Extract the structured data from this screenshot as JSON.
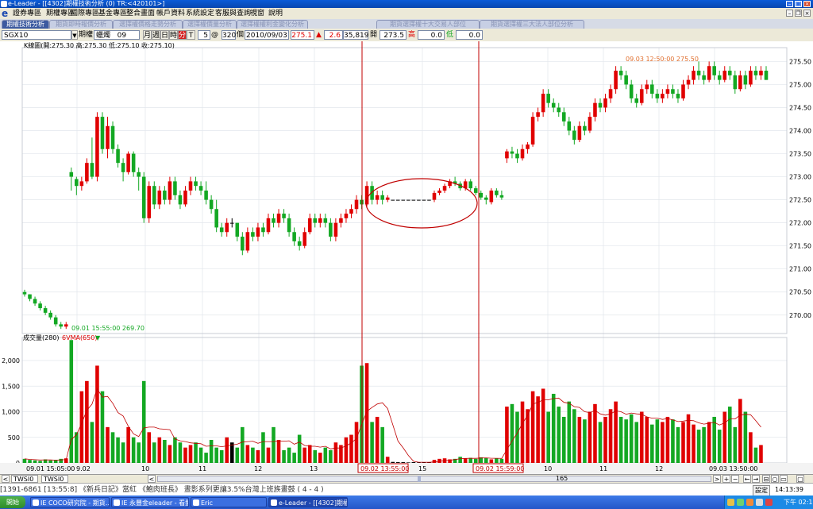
{
  "window": {
    "title": "e-Leader - [[4302]期權技術分析  (0)  TR:<420101>]"
  },
  "menu": {
    "items": [
      "證券專區",
      "期權專區",
      "國際專區",
      "基金專區",
      "整合畫面",
      "帳戶資料",
      "系統設定",
      "客服與查詢",
      "視窗",
      "說明"
    ]
  },
  "tabs": [
    {
      "label": "期權技術分析",
      "active": true
    },
    {
      "label": "期貨即時報價分析",
      "active": false
    },
    {
      "label": "選擇權價格走勢分析",
      "active": false
    },
    {
      "label": "選擇權價量分析",
      "active": false
    },
    {
      "label": "選擇權權利金變化分析",
      "active": false
    },
    {
      "label": "期貨選擇權十大交易人部位",
      "active": false
    },
    {
      "label": "期貨選擇權三大法人部位分析",
      "active": false
    }
  ],
  "toolbar": {
    "symbol": "SGX10",
    "period_label": "期權",
    "chart_type": "蠟燭",
    "chart_type_value": "09",
    "buttons": [
      "月",
      "週",
      "日",
      "時",
      "分",
      "T"
    ],
    "count": "5",
    "count_unit": "@",
    "bars": "320",
    "bars_unit": "個",
    "date": "2010/09/03",
    "last_price": "275.1",
    "change_arrow": "▲",
    "change": "2.6",
    "volume": "35,819",
    "open_label": "開",
    "open": "273.5",
    "high_label": "高",
    "high": "0.0",
    "low_label": "低",
    "low": "0.0"
  },
  "price_panel": {
    "header": "K線圖(開:275.30 高:275.30 低:275.10 收:275.10)",
    "y_ticks": [
      "275.50",
      "275.00",
      "274.50",
      "274.00",
      "273.50",
      "273.00",
      "272.50",
      "272.00",
      "271.50",
      "271.00",
      "270.50",
      "270.00"
    ],
    "annotation_high": "09.03 12:50:00   275.50",
    "annotation_low": "09.01 15:55:00   269.70"
  },
  "volume_panel": {
    "header_label": "成交量(280)",
    "header_ma": "6VMA(650)",
    "header_arrow": "▼",
    "y_ticks": [
      "2,000",
      "1,500",
      "1,000",
      "500",
      "0"
    ]
  },
  "x_axis": {
    "labels": [
      "09.01 15:05:00",
      "9.02",
      "10",
      "11",
      "12",
      "13",
      "15",
      "10",
      "11",
      "12",
      "09.03 13:50:00"
    ],
    "cursor_left": "09.02 13:55:00",
    "cursor_right": "09.02 15:59:00"
  },
  "status": {
    "left_symbol": "TWSI0",
    "left_symbol2": "TWSI0",
    "scroll_value": "165",
    "setting_label": "設定",
    "time": "14:13:39"
  },
  "ticker": {
    "text": "[1391-6861 [13:55:8]  《新兵日記》當紅 《鮑肉班長》 晝影系列更讓3.5%台灣上班族畫鼓 ( 4 - 4 )"
  },
  "taskbar": {
    "start": "開始",
    "tasks": [
      "IE COCO研究院 - 期貨…",
      "IE 永豐金eleader - 看盤…",
      "Eric",
      "e-Leader - [[4302]期權技…"
    ],
    "clock": "下午 02:13"
  },
  "colors": {
    "up": "#e00000",
    "down": "#13a823",
    "flat": "#000000",
    "cursor": "#c00000",
    "ma_line": "#c00000",
    "grid": "#e2e6ec"
  },
  "chart_data": [
    {
      "type": "candlestick",
      "ylim": [
        269.6,
        275.8
      ],
      "y_ticks": [
        270.0,
        270.5,
        271.0,
        271.5,
        272.0,
        272.5,
        273.0,
        273.5,
        274.0,
        274.5,
        275.0,
        275.5
      ],
      "annotations": [
        {
          "label": "09.03 12:50:00",
          "value": 275.5
        },
        {
          "label": "09.01 15:55:00",
          "value": 269.7
        }
      ],
      "ohlc": [
        [
          270.5,
          270.55,
          270.4,
          270.45
        ],
        [
          270.45,
          270.45,
          270.3,
          270.35
        ],
        [
          270.35,
          270.4,
          270.2,
          270.25
        ],
        [
          270.25,
          270.3,
          270.1,
          270.15
        ],
        [
          270.15,
          270.2,
          270.0,
          270.05
        ],
        [
          270.05,
          270.1,
          269.9,
          269.95
        ],
        [
          269.95,
          270.0,
          269.75,
          269.8
        ],
        [
          269.8,
          269.85,
          269.7,
          269.75
        ],
        [
          269.75,
          269.85,
          269.7,
          269.8
        ],
        [
          273.1,
          273.2,
          272.7,
          273.0
        ],
        [
          272.95,
          273.0,
          272.6,
          272.8
        ],
        [
          272.8,
          273.0,
          272.7,
          272.9
        ],
        [
          272.9,
          273.4,
          272.85,
          273.3
        ],
        [
          273.3,
          273.85,
          272.95,
          273.0
        ],
        [
          273.0,
          274.4,
          272.9,
          274.3
        ],
        [
          274.3,
          274.4,
          273.5,
          273.6
        ],
        [
          273.6,
          274.3,
          273.4,
          274.1
        ],
        [
          274.1,
          274.2,
          273.5,
          273.6
        ],
        [
          273.6,
          273.7,
          273.2,
          273.3
        ],
        [
          273.3,
          273.4,
          272.9,
          273.1
        ],
        [
          273.1,
          273.55,
          273.05,
          273.5
        ],
        [
          273.5,
          273.55,
          273.0,
          273.1
        ],
        [
          273.1,
          273.2,
          272.7,
          273.0
        ],
        [
          273.0,
          273.1,
          272.0,
          272.1
        ],
        [
          272.1,
          272.9,
          272.0,
          272.8
        ],
        [
          272.8,
          272.9,
          272.3,
          272.4
        ],
        [
          272.4,
          272.8,
          272.3,
          272.7
        ],
        [
          272.7,
          272.8,
          272.4,
          272.5
        ],
        [
          272.5,
          273.0,
          272.4,
          272.9
        ],
        [
          272.9,
          273.0,
          272.5,
          272.6
        ],
        [
          272.6,
          272.7,
          272.3,
          272.4
        ],
        [
          272.4,
          272.8,
          272.35,
          272.7
        ],
        [
          272.7,
          273.0,
          272.6,
          272.9
        ],
        [
          272.9,
          273.0,
          272.7,
          272.8
        ],
        [
          272.8,
          272.9,
          272.6,
          272.7
        ],
        [
          272.7,
          272.9,
          272.4,
          272.5
        ],
        [
          272.5,
          272.6,
          272.2,
          272.3
        ],
        [
          272.3,
          272.5,
          271.8,
          271.9
        ],
        [
          271.9,
          272.0,
          271.7,
          271.8
        ],
        [
          271.8,
          272.1,
          271.7,
          272.0
        ],
        [
          272.0,
          272.1,
          271.9,
          272.0
        ],
        [
          272.0,
          272.0,
          271.6,
          271.7
        ],
        [
          271.7,
          271.8,
          271.3,
          271.4
        ],
        [
          271.4,
          271.9,
          271.35,
          271.8
        ],
        [
          271.8,
          271.9,
          271.6,
          271.7
        ],
        [
          271.7,
          272.0,
          271.6,
          271.9
        ],
        [
          271.9,
          272.0,
          271.7,
          271.8
        ],
        [
          271.8,
          272.2,
          271.75,
          272.1
        ],
        [
          272.1,
          272.2,
          271.9,
          272.0
        ],
        [
          272.0,
          272.3,
          271.9,
          272.2
        ],
        [
          272.2,
          272.3,
          272.0,
          272.1
        ],
        [
          272.1,
          272.2,
          271.7,
          271.8
        ],
        [
          271.8,
          271.9,
          271.5,
          271.6
        ],
        [
          271.6,
          271.7,
          271.4,
          271.5
        ],
        [
          271.5,
          271.9,
          271.45,
          271.8
        ],
        [
          271.8,
          272.2,
          271.75,
          272.1
        ],
        [
          272.1,
          272.2,
          271.9,
          272.0
        ],
        [
          272.0,
          272.2,
          271.9,
          272.1
        ],
        [
          272.1,
          272.2,
          271.9,
          272.0
        ],
        [
          272.0,
          272.1,
          271.6,
          271.7
        ],
        [
          271.7,
          272.1,
          271.6,
          272.0
        ],
        [
          272.0,
          272.2,
          271.9,
          272.1
        ],
        [
          272.1,
          272.3,
          272.0,
          272.2
        ],
        [
          272.2,
          272.4,
          272.1,
          272.3
        ],
        [
          272.3,
          272.6,
          272.2,
          272.5
        ],
        [
          272.5,
          272.6,
          272.3,
          272.4
        ],
        [
          272.4,
          272.9,
          272.35,
          272.8
        ],
        [
          272.8,
          272.9,
          272.4,
          272.5
        ],
        [
          272.5,
          272.7,
          272.4,
          272.6
        ],
        [
          272.6,
          272.7,
          272.4,
          272.5
        ],
        [
          272.5,
          272.6,
          272.45,
          272.55
        ],
        [
          272.5,
          272.5,
          272.5,
          272.5
        ],
        [
          272.5,
          272.5,
          272.5,
          272.5
        ],
        [
          272.5,
          272.5,
          272.5,
          272.5
        ],
        [
          272.5,
          272.5,
          272.5,
          272.5
        ],
        [
          272.5,
          272.5,
          272.5,
          272.5
        ],
        [
          272.5,
          272.5,
          272.5,
          272.5
        ],
        [
          272.5,
          272.5,
          272.5,
          272.5
        ],
        [
          272.5,
          272.5,
          272.5,
          272.5
        ],
        [
          272.5,
          272.7,
          272.45,
          272.65
        ],
        [
          272.65,
          272.75,
          272.6,
          272.7
        ],
        [
          272.7,
          272.85,
          272.65,
          272.8
        ],
        [
          272.8,
          272.95,
          272.75,
          272.9
        ],
        [
          272.9,
          273.0,
          272.8,
          272.85
        ],
        [
          272.85,
          272.9,
          272.7,
          272.75
        ],
        [
          272.75,
          272.95,
          272.7,
          272.9
        ],
        [
          272.9,
          272.95,
          272.7,
          272.75
        ],
        [
          272.75,
          272.8,
          272.6,
          272.65
        ],
        [
          272.65,
          272.7,
          272.5,
          272.55
        ],
        [
          272.55,
          272.6,
          272.4,
          272.5
        ],
        [
          272.45,
          272.75,
          272.4,
          272.7
        ],
        [
          272.7,
          272.75,
          272.55,
          272.6
        ],
        [
          272.6,
          272.7,
          272.5,
          272.55
        ],
        [
          273.4,
          273.6,
          273.3,
          273.55
        ],
        [
          273.55,
          273.65,
          273.4,
          273.5
        ],
        [
          273.5,
          273.6,
          273.3,
          273.4
        ],
        [
          273.4,
          273.7,
          273.35,
          273.6
        ],
        [
          273.6,
          273.75,
          273.5,
          273.7
        ],
        [
          273.7,
          274.4,
          273.65,
          274.3
        ],
        [
          274.3,
          274.5,
          274.2,
          274.4
        ],
        [
          274.4,
          274.9,
          274.3,
          274.8
        ],
        [
          274.8,
          274.9,
          274.5,
          274.6
        ],
        [
          274.6,
          274.7,
          274.4,
          274.5
        ],
        [
          274.5,
          274.6,
          274.3,
          274.4
        ],
        [
          274.4,
          274.5,
          274.1,
          274.2
        ],
        [
          274.2,
          274.3,
          273.9,
          274.0
        ],
        [
          274.0,
          274.1,
          273.7,
          273.8
        ],
        [
          273.8,
          274.2,
          273.75,
          274.1
        ],
        [
          274.1,
          274.2,
          273.9,
          274.0
        ],
        [
          274.0,
          274.4,
          273.95,
          274.3
        ],
        [
          274.3,
          274.7,
          274.2,
          274.6
        ],
        [
          274.6,
          274.7,
          274.4,
          274.5
        ],
        [
          274.5,
          274.8,
          274.4,
          274.7
        ],
        [
          274.7,
          275.0,
          274.6,
          274.9
        ],
        [
          274.9,
          275.4,
          274.8,
          275.3
        ],
        [
          275.3,
          275.4,
          275.1,
          275.2
        ],
        [
          275.2,
          275.3,
          274.9,
          275.0
        ],
        [
          275.0,
          275.1,
          274.6,
          274.7
        ],
        [
          274.7,
          274.8,
          274.5,
          274.6
        ],
        [
          274.6,
          275.0,
          274.55,
          274.9
        ],
        [
          274.9,
          275.1,
          274.8,
          275.0
        ],
        [
          275.0,
          275.1,
          274.7,
          274.8
        ],
        [
          274.8,
          274.9,
          274.6,
          274.7
        ],
        [
          274.7,
          274.9,
          274.6,
          274.8
        ],
        [
          274.8,
          275.0,
          274.7,
          274.9
        ],
        [
          274.9,
          275.0,
          274.7,
          274.8
        ],
        [
          274.8,
          274.9,
          274.6,
          274.7
        ],
        [
          274.7,
          275.1,
          274.65,
          275.0
        ],
        [
          275.0,
          275.2,
          274.9,
          275.1
        ],
        [
          275.1,
          275.4,
          275.0,
          275.3
        ],
        [
          275.3,
          275.5,
          275.1,
          275.2
        ],
        [
          275.2,
          275.3,
          275.0,
          275.1
        ],
        [
          275.1,
          275.5,
          275.05,
          275.4
        ],
        [
          275.4,
          275.5,
          275.1,
          275.2
        ],
        [
          275.2,
          275.3,
          275.0,
          275.1
        ],
        [
          275.1,
          275.4,
          275.05,
          275.3
        ],
        [
          275.3,
          275.4,
          275.1,
          275.2
        ],
        [
          275.2,
          275.3,
          274.8,
          274.9
        ],
        [
          274.9,
          275.3,
          274.85,
          275.2
        ],
        [
          275.2,
          275.3,
          274.9,
          275.0
        ],
        [
          275.0,
          275.4,
          274.95,
          275.3
        ],
        [
          275.3,
          275.4,
          275.1,
          275.2
        ],
        [
          275.2,
          275.4,
          275.1,
          275.3
        ],
        [
          275.3,
          275.4,
          275.1,
          275.1
        ]
      ]
    },
    {
      "type": "bar",
      "ylim": [
        0,
        2450
      ],
      "y_ticks": [
        0,
        500,
        1000,
        1500,
        2000
      ],
      "series": [
        {
          "name": "6VMA(650)",
          "type": "line"
        }
      ],
      "values": [
        80,
        60,
        50,
        40,
        70,
        50,
        60,
        80,
        90,
        2400,
        600,
        1400,
        1600,
        800,
        1900,
        1400,
        700,
        600,
        500,
        400,
        700,
        500,
        400,
        1600,
        600,
        400,
        500,
        450,
        350,
        500,
        400,
        300,
        350,
        400,
        300,
        200,
        450,
        300,
        250,
        500,
        400,
        300,
        700,
        350,
        300,
        250,
        600,
        300,
        700,
        450,
        250,
        300,
        200,
        550,
        300,
        350,
        250,
        200,
        300,
        250,
        400,
        350,
        500,
        550,
        800,
        1900,
        1950,
        800,
        900,
        700,
        120,
        20,
        15,
        15,
        10,
        15,
        10,
        15,
        10,
        60,
        80,
        90,
        70,
        80,
        120,
        90,
        100,
        80,
        110,
        100,
        70,
        90,
        80,
        1100,
        1150,
        1000,
        1200,
        1050,
        1400,
        1300,
        1450,
        1000,
        1350,
        1100,
        900,
        1200,
        1050,
        900,
        850,
        1000,
        1150,
        800,
        900,
        1050,
        1200,
        900,
        850,
        950,
        800,
        1000,
        900,
        750,
        850,
        800,
        900,
        850,
        700,
        800,
        950,
        750,
        650,
        700,
        800,
        900,
        650,
        1000,
        1100,
        700,
        1250,
        1000,
        600,
        300,
        350
      ]
    }
  ]
}
